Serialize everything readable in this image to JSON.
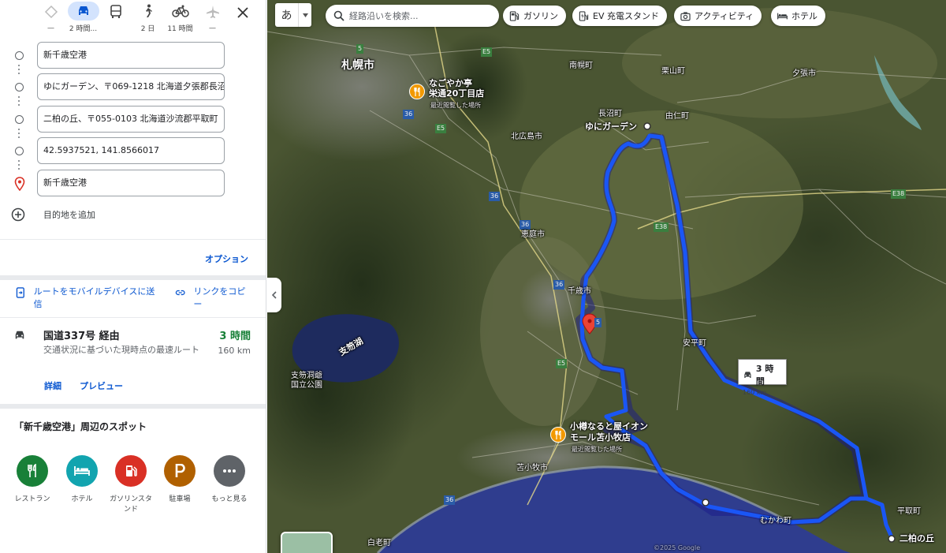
{
  "travel_modes": [
    {
      "name": "best",
      "label": "—",
      "active": false
    },
    {
      "name": "car",
      "label": "2 時間...",
      "active": true
    },
    {
      "name": "transit",
      "label": "",
      "active": false
    },
    {
      "name": "walk",
      "label": "2 日",
      "active": false
    },
    {
      "name": "bike",
      "label": "11 時間",
      "active": false
    },
    {
      "name": "flight",
      "label": "—",
      "active": false
    }
  ],
  "stops": [
    "新千歳空港",
    "ゆにガーデン、〒069-1218 北海道夕張郡長沼町",
    "二柏の丘、〒055-0103 北海道沙流郡平取町",
    "42.5937521, 141.8566017",
    "新千歳空港"
  ],
  "add_destination": "目的地を追加",
  "options_label": "オプション",
  "share": {
    "send_to_mobile": "ルートをモバイルデバイスに送信",
    "copy_link": "リンクをコピー"
  },
  "route": {
    "name": "国道337号 経由",
    "time": "3 時間",
    "distance": "160 km",
    "description": "交通状況に基づいた現時点の最速ルート",
    "details_label": "詳細",
    "preview_label": "プレビュー"
  },
  "nearby": {
    "title": "「新千歳空港」周辺のスポット",
    "items": [
      {
        "label": "レストラン",
        "icon": "restaurant-icon",
        "color": "#188038",
        "glyph": "††"
      },
      {
        "label": "ホテル",
        "icon": "hotel-icon",
        "color": "#12a4af",
        "glyph": "▬"
      },
      {
        "label": "ガソリンスタンド",
        "icon": "gas-station-icon",
        "color": "#d93025",
        "glyph": "■"
      },
      {
        "label": "駐車場",
        "icon": "parking-icon",
        "color": "#b06000",
        "glyph": "P"
      },
      {
        "label": "もっと見る",
        "icon": "more-icon",
        "color": "#5f6368",
        "glyph": "•••"
      }
    ]
  },
  "map": {
    "ime_label": "あ",
    "search_placeholder": "経路沿いを検索...",
    "chips": [
      {
        "label": "ガソリン",
        "icon": "gas-icon"
      },
      {
        "label": "EV 充電スタンド",
        "icon": "ev-charger-icon"
      },
      {
        "label": "アクティビティ",
        "icon": "camera-icon"
      },
      {
        "label": "ホテル",
        "icon": "bed-icon"
      }
    ],
    "labels": {
      "sapporo": "札幌市",
      "restaurant_1_name": "なごやか亭",
      "restaurant_1_branch": "栄通20丁目店",
      "restaurant_1_sub": "最近閲覧した場所",
      "yuni_garden": "ゆにガーデン",
      "nanporo": "南幌町",
      "kuriyama": "栗山町",
      "yubari": "夕張市",
      "naganuma": "長沼町",
      "yuni": "由仁町",
      "kitahiroshima": "北広島市",
      "eniwa": "恵庭市",
      "chitose": "千歳市",
      "abira": "安平町",
      "shikotsu_lake": "支笏湖",
      "shikotsu_park": "支笏洞爺\n国立公園",
      "restaurant_2_name": "小樽なると屋イオン",
      "restaurant_2_branch": "モール苫小牧店",
      "restaurant_2_sub": "最近閲覧した場所",
      "tomakomai": "苫小牧市",
      "mukawa": "むかわ町",
      "biratori": "平取町",
      "nikashiwa": "二柏の丘",
      "shiraoi": "白老町",
      "copyright": "©2025 Google"
    },
    "road_numbers": [
      "5",
      "E5",
      "36",
      "36",
      "E5",
      "36",
      "36",
      "E38",
      "E38",
      "E5",
      "36",
      "5",
      "E5"
    ],
    "route_info": {
      "time": "3 時間",
      "distance": "160 km"
    },
    "colors": {
      "route": "#1a56f5",
      "land": "#3f4a2a",
      "sea": "#2f3d8e",
      "lake": "#1e2b5e"
    }
  }
}
